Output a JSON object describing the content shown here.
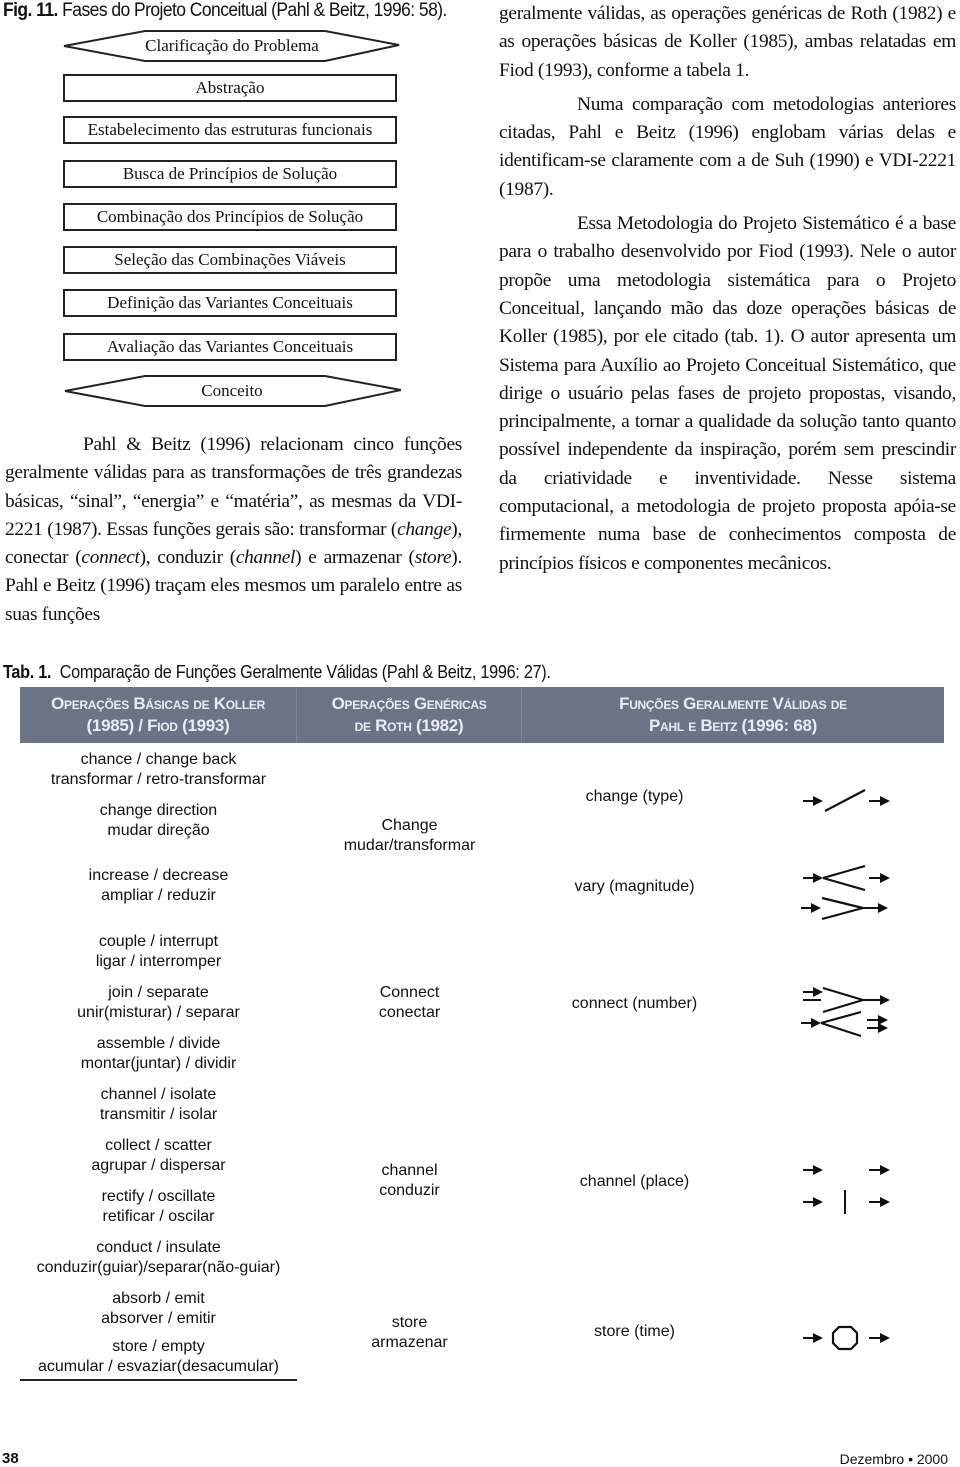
{
  "figure": {
    "label": "Fig. 11.",
    "caption": "Fases do Projeto Conceitual (Pahl & Beitz, 1996: 58).",
    "phases": [
      {
        "label": "Clarificação do Problema",
        "shape": "hexagon"
      },
      {
        "label": "Abstração",
        "shape": "box"
      },
      {
        "label": "Estabelecimento das estruturas funcionais",
        "shape": "box"
      },
      {
        "label": "Busca de Princípios de Solução",
        "shape": "box"
      },
      {
        "label": "Combinação dos Princípios de Solução",
        "shape": "box"
      },
      {
        "label": "Seleção das Combinações Viáveis",
        "shape": "box"
      },
      {
        "label": "Definição das Variantes Conceituais",
        "shape": "box"
      },
      {
        "label": "Avaliação das Variantes Conceituais",
        "shape": "box"
      },
      {
        "label": "Conceito",
        "shape": "hexagon"
      }
    ]
  },
  "left_column": {
    "p1_a": "Pahl & Beitz (1996) relacionam cinco funções geralmente válidas para as transformações de três grandezas básicas, “sinal”, “energia” e “matéria”, as mesmas da VDI-2221 (1987). Essas funções gerais são: transformar (",
    "p1_change": "change",
    "p1_b": "), conectar (",
    "p1_connect": "connect",
    "p1_c": "), condu­zir (",
    "p1_channel": "channel",
    "p1_d": ") e armazenar (",
    "p1_store": "store",
    "p1_e": "). Pahl e Beitz (1996) traçam eles mesmos um paralelo entre as suas funções"
  },
  "right_column": {
    "p1": "geralmente válidas, as operações genéricas de Roth (1982) e as operações básicas de Koller (1985), ambas relatadas em Fiod (1993), conforme a tabela 1.",
    "p2": "Numa comparação com metodologias anterio­res citadas, Pahl e Beitz (1996) englobam várias delas e identificam-se claramente com a de Suh (1990) e VDI-2221 (1987).",
    "p3": "Essa Metodologia do Projeto Sistemático é a base para o trabalho desenvolvido por Fiod (1993). Nele o autor propõe uma metodologia sistemática para o Projeto Conceitual, lançando mão das doze operações básicas de Koller (1985), por ele citado (tab. 1). O autor apresenta um Sistema para Auxílio ao Projeto Conceitual Sistemático, que dirige o usuá­rio pelas fases de projeto propostas, visando, princi­palmente, a tornar a qualidade da solução tanto quanto possível independente da inspiração, porém sem prescindir da criatividade e inventividade. Nesse sistema computacional, a metodologia de projeto proposta apóia-se firmemente numa base de conhecimentos composta de princípios físicos e componentes mecânicos."
  },
  "table": {
    "label": "Tab. 1.",
    "caption": "Comparação de Funções Geralmente Válidas (Pahl & Beitz, 1996: 27).",
    "header_color": "#6b7486",
    "headers": [
      {
        "line1": "Operações Básicas de Koller",
        "line2": "(1985) / Fiod (1993)"
      },
      {
        "line1": "Operações Genéricas",
        "line2": "de Roth (1982)"
      },
      {
        "line1": "Funções Geralmente Válidas de",
        "line2": "Pahl e Beitz (1996: 68)"
      }
    ],
    "koller": [
      {
        "en": "chance / change back",
        "pt": "transformar / retro-transformar"
      },
      {
        "en": "change direction",
        "pt": "mudar direção"
      },
      {
        "en": "increase / decrease",
        "pt": "ampliar / reduzir"
      },
      {
        "en": "couple / interrupt",
        "pt": "ligar / interromper"
      },
      {
        "en": "join / separate",
        "pt": "unir(misturar) / separar"
      },
      {
        "en": "assemble / divide",
        "pt": "montar(juntar) / dividir"
      },
      {
        "en": "channel / isolate",
        "pt": "transmitir / isolar"
      },
      {
        "en": "collect / scatter",
        "pt": "agrupar / dispersar"
      },
      {
        "en": "rectify / oscillate",
        "pt": "retificar / oscilar"
      },
      {
        "en": "conduct / insulate",
        "pt": "conduzir(guiar)/separar(não-guiar)"
      },
      {
        "en": "absorb / emit",
        "pt": "absorver / emitir"
      },
      {
        "en": "store / empty",
        "pt": "acumular / esvaziar(desacumular)"
      }
    ],
    "roth": [
      {
        "en": "Change",
        "pt": "mudar/transformar"
      },
      {
        "en": "Connect",
        "pt": "conectar"
      },
      {
        "en": "channel",
        "pt": "conduzir"
      },
      {
        "en": "store",
        "pt": "armazenar"
      }
    ],
    "pahl": [
      {
        "label": "change (type)",
        "symbol": "switch-symbol-icon"
      },
      {
        "label": "vary (magnitude)",
        "symbol": "amplify-reduce-symbol-icon"
      },
      {
        "label": "connect (number)",
        "symbol": "join-split-symbol-icon"
      },
      {
        "label": "channel (place)",
        "symbol": "conduct-insulate-symbol-icon"
      },
      {
        "label": "store (time)",
        "symbol": "storage-symbol-icon"
      }
    ]
  },
  "footer": {
    "page_number": "38",
    "date": "Dezembro • 2000"
  }
}
